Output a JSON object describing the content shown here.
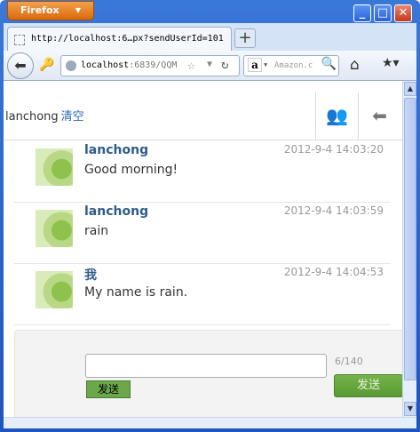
{
  "browser": {
    "menu_label": "Firefox",
    "tab_title": "http://localhost:6…px?sendUserId=101",
    "new_tab": "+",
    "url_host": "localhost",
    "url_rest": ":6839/QQM",
    "search_placeholder": "Amazon.c"
  },
  "header": {
    "title": "lanchong",
    "clear_label": "清空"
  },
  "messages": [
    {
      "name": "lanchong",
      "time": "2012-9-4 14:03:20",
      "text": "Good morning!"
    },
    {
      "name": "lanchong",
      "time": "2012-9-4 14:03:59",
      "text": "rain"
    },
    {
      "name": "我",
      "time": "2012-9-4 14:04:53",
      "text": "My name is rain."
    }
  ],
  "composer": {
    "counter": "6/140",
    "small_send_label": "发送",
    "send_label": "发送"
  },
  "colors": {
    "accent": "#2e5c8a",
    "send_green": "#6aa84a"
  }
}
